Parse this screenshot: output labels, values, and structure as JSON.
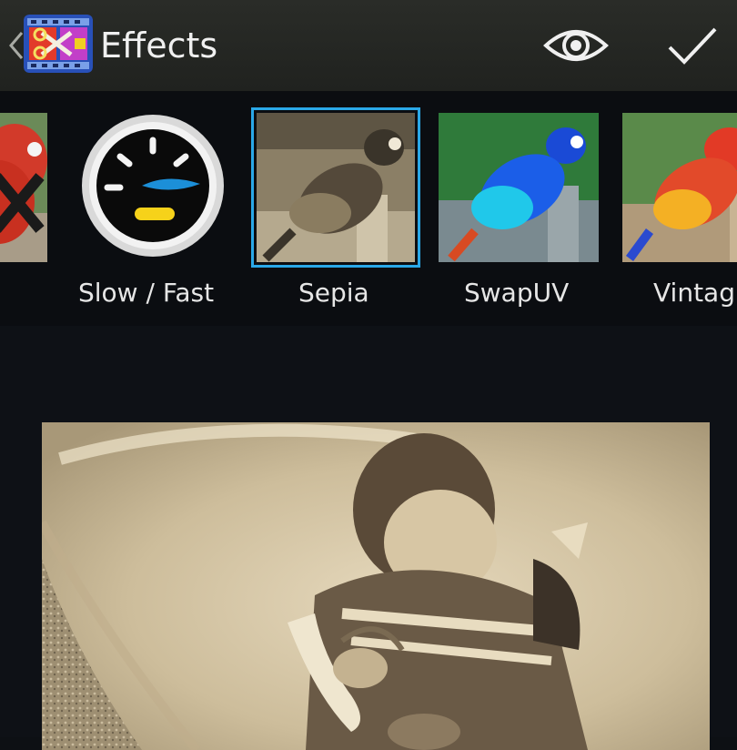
{
  "header": {
    "title": "Effects",
    "back_icon": "chevron-left-icon",
    "app_icon": "video-editor-app-icon",
    "preview_icon": "eye-icon",
    "confirm_icon": "checkmark-icon"
  },
  "effects": {
    "items": [
      {
        "label": "",
        "icon": "remove-effect-thumbnail"
      },
      {
        "label": "Slow / Fast",
        "icon": "speedometer-icon"
      },
      {
        "label": "Sepia",
        "icon": "sepia-parrot-thumbnail",
        "selected": true
      },
      {
        "label": "SwapUV",
        "icon": "swapuv-parrot-thumbnail"
      },
      {
        "label": "Vintag",
        "icon": "vintage-parrot-thumbnail"
      }
    ]
  },
  "colors": {
    "accent": "#2aa8e8",
    "bar_background": "#2a2c28",
    "background": "#0d1014",
    "sepia": "#c9b99a"
  }
}
